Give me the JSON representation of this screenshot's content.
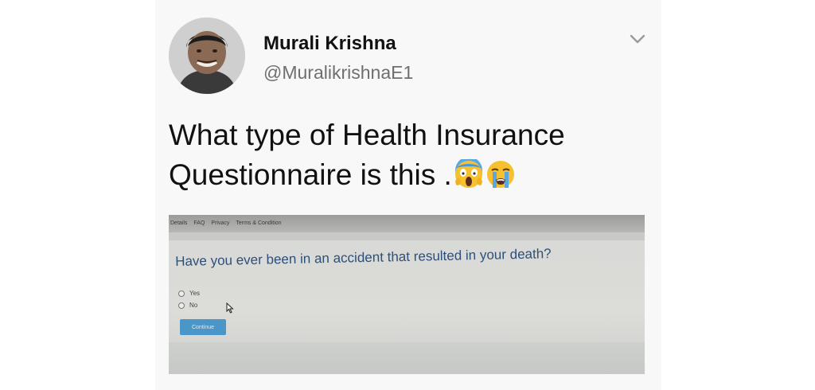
{
  "tweet": {
    "author": {
      "name": "Murali Krishna",
      "handle": "@MuralikrishnaE1",
      "avatar_icon": "profile-photo"
    },
    "menu_icon": "chevron-down-icon",
    "text": "What type of Health Insurance Questionnaire is this .",
    "emojis": [
      "face-screaming-in-fear",
      "loudly-crying-face"
    ]
  },
  "embedded_screen": {
    "nav": [
      "Details",
      "FAQ",
      "Privacy",
      "Terms & Condition"
    ],
    "question": "Have you ever been in an accident that resulted in your death?",
    "options": [
      "Yes",
      "No"
    ],
    "continue_label": "Continue"
  },
  "colors": {
    "card_bg": "#f8f8f8",
    "name": "#111111",
    "handle": "#6f6f6f",
    "question": "#2d4f78",
    "button": "#4a96c8"
  }
}
